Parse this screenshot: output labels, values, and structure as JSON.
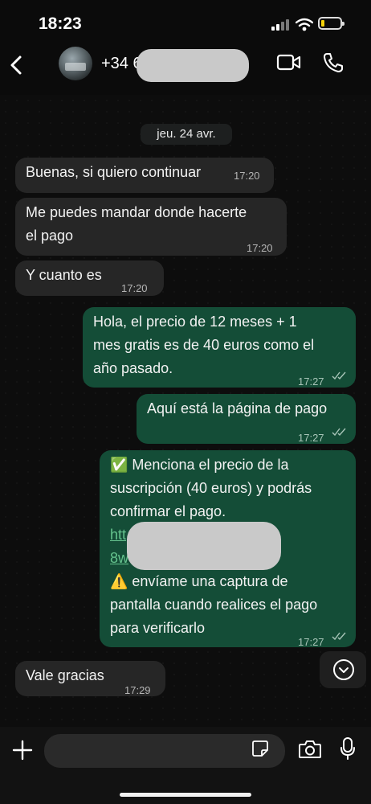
{
  "status_bar": {
    "time": "18:23",
    "battery_level": 0.2
  },
  "header": {
    "contact_name": "+34 6"
  },
  "chat": {
    "date_separator": "jeu. 24 avr.",
    "messages": [
      {
        "direction": "in",
        "lines": [
          "Buenas, si quiero continuar"
        ],
        "time": "17:20"
      },
      {
        "direction": "in",
        "lines": [
          "Me puedes mandar donde hacerte",
          "el pago"
        ],
        "time": "17:20"
      },
      {
        "direction": "in",
        "lines": [
          "Y cuanto es"
        ],
        "time": "17:20"
      },
      {
        "direction": "out",
        "lines": [
          "Hola, el precio de 12 meses + 1",
          "mes gratis es de 40 euros como el",
          "año pasado."
        ],
        "time": "17:27"
      },
      {
        "direction": "out",
        "lines": [
          "Aquí está la página de pago"
        ],
        "time": "17:27"
      },
      {
        "direction": "out",
        "lines": [
          "✅ Menciona el precio de la",
          "suscripción (40 euros) y podrás",
          "confirmar el pago.",
          "htt",
          "8w",
          "⚠️ envíame una captura de",
          "pantalla cuando realices el pago",
          "para verificarlo"
        ],
        "time": "17:27"
      },
      {
        "direction": "in",
        "lines": [
          "Vale gracias"
        ],
        "time": "17:29"
      }
    ]
  },
  "icons": {
    "back": "chevron-left-icon",
    "video": "video-camera-icon",
    "phone": "phone-icon",
    "scroll_down": "chevron-down-icon",
    "attach": "plus-icon",
    "sticker": "sticker-icon",
    "camera": "camera-icon",
    "mic": "microphone-icon"
  },
  "colors": {
    "incoming_bubble": "#262626",
    "outgoing_bubble": "#144d37",
    "link": "#65c38e",
    "battery": "#f5d20a"
  }
}
